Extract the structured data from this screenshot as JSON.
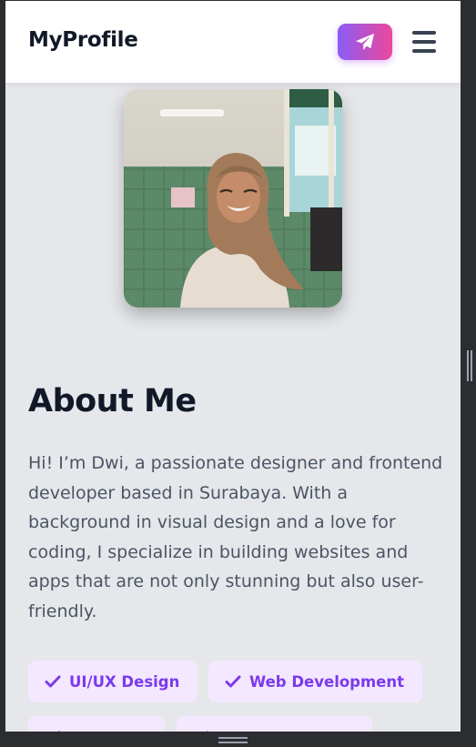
{
  "navbar": {
    "brand": "MyProfile",
    "send_icon": "paper-plane-icon",
    "menu_icon": "hamburger-menu-icon",
    "accent_gradient": [
      "#8b5cf6",
      "#ec4899"
    ]
  },
  "profile": {
    "photo_icon": "profile-photo"
  },
  "about": {
    "title": "About Me",
    "text": "Hi! I’m Dwi, a passionate designer and frontend developer based in Surabaya. With a background in visual design and a love for coding, I specialize in building websites and apps that are not only stunning but also user-friendly."
  },
  "skills": [
    {
      "label": "UI/UX Design",
      "icon": "check-icon"
    },
    {
      "label": "Web Development",
      "icon": "check-icon"
    },
    {
      "label": "",
      "icon": "check-icon"
    },
    {
      "label": "",
      "icon": "check-icon"
    }
  ],
  "colors": {
    "page_bg": "#e5e7eb",
    "tag_bg": "#f3e8ff",
    "tag_text": "#7c3aed",
    "heading": "#111827",
    "body_text": "#4b5563"
  }
}
